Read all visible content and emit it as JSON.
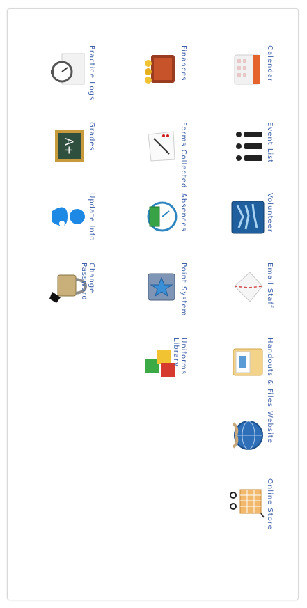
{
  "columns": [
    {
      "items": [
        {
          "label": "Calendar",
          "icon": "calendar-icon"
        },
        {
          "label": "Event List",
          "icon": "event-list-icon"
        },
        {
          "label": "Volunteer",
          "icon": "volunteer-icon"
        },
        {
          "label": "Email Staff",
          "icon": "email-icon"
        },
        {
          "label": "Handouts & Files",
          "icon": "folder-icon"
        },
        {
          "label": "Website",
          "icon": "website-globe-icon"
        },
        {
          "label": "Online Store",
          "icon": "shopping-cart-icon"
        }
      ]
    },
    {
      "items": [
        {
          "label": "Finances",
          "icon": "finances-icon"
        },
        {
          "label": "Forms Collected",
          "icon": "forms-collected-icon"
        },
        {
          "label": "Absences",
          "icon": "absences-clock-icon"
        },
        {
          "label": "Point System",
          "icon": "point-system-icon"
        },
        {
          "label": "Uniforms Library",
          "icon": "uniforms-boxes-icon"
        }
      ]
    },
    {
      "items": [
        {
          "label": "Practice Logs",
          "icon": "stopwatch-icon"
        },
        {
          "label": "Grades",
          "icon": "grades-chalkboard-icon"
        },
        {
          "label": "Update Info",
          "icon": "update-info-user-icon"
        },
        {
          "label": "Change Password",
          "icon": "padlock-icon"
        }
      ]
    }
  ]
}
